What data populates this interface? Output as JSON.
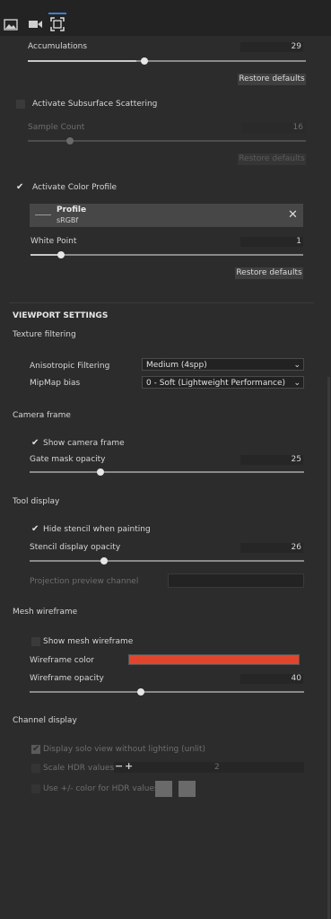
{
  "colors": {
    "accent": "#3c7fd1",
    "wireframe": "#e0462d"
  },
  "tabs": [
    {
      "icon": "image-icon"
    },
    {
      "icon": "video-icon"
    },
    {
      "icon": "frame-icon",
      "active": true
    }
  ],
  "accumulations": {
    "label": "Accumulations",
    "value": "29",
    "fraction": 0.39,
    "restore": "Restore defaults"
  },
  "subsurface": {
    "label": "Activate Subsurface Scattering",
    "checked": false,
    "sample_count_label": "Sample Count",
    "sample_count_value": "16",
    "fraction": 0.15,
    "restore": "Restore defaults"
  },
  "color_profile": {
    "label": "Activate Color Profile",
    "checked": true,
    "profile_title": "Profile",
    "profile_value": "sRGBf",
    "white_point_label": "White Point",
    "white_point_value": "1",
    "fraction": 0.1,
    "restore": "Restore defaults"
  },
  "viewport": {
    "title": "VIEWPORT SETTINGS",
    "texture_filtering": {
      "heading": "Texture filtering",
      "anisotropic_label": "Anisotropic Filtering",
      "anisotropic_value": "Medium (4spp)",
      "mipmap_label": "MipMap bias",
      "mipmap_value": "0 - Soft (Lightweight Performance)"
    },
    "camera_frame": {
      "heading": "Camera frame",
      "show_label": "Show camera frame",
      "show_checked": true,
      "gate_label": "Gate mask opacity",
      "gate_value": "25",
      "gate_fraction": 0.25
    },
    "tool_display": {
      "heading": "Tool display",
      "hide_stencil_label": "Hide stencil when painting",
      "hide_stencil_checked": true,
      "stencil_opacity_label": "Stencil display opacity",
      "stencil_opacity_value": "26",
      "stencil_fraction": 0.26,
      "projection_label": "Projection preview channel"
    },
    "mesh_wireframe": {
      "heading": "Mesh wireframe",
      "show_label": "Show mesh wireframe",
      "show_checked": false,
      "color_label": "Wireframe color",
      "opacity_label": "Wireframe opacity",
      "opacity_value": "40",
      "opacity_fraction": 0.4
    },
    "channel_display": {
      "heading": "Channel display",
      "solo_label": "Display solo view without lighting (unlit)",
      "solo_checked": true,
      "scale_hdr_label": "Scale HDR values",
      "scale_hdr_value": "2",
      "use_color_label": "Use +/- color for HDR values"
    }
  }
}
